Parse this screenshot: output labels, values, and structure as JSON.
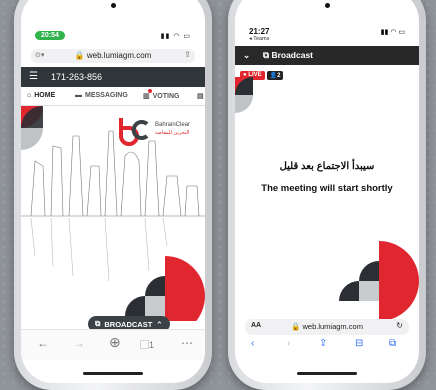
{
  "left_phone": {
    "status_time": "20:54",
    "url": "web.lumiagm.com",
    "meeting_id": "171-263-856",
    "tabs": [
      {
        "label": "HOME"
      },
      {
        "label": "MESSAGING"
      },
      {
        "label": "VOTING"
      }
    ],
    "logo_title": "BahrainClear",
    "logo_arabic": "البحرين للمقاصة",
    "broadcast_label": "BROADCAST"
  },
  "right_phone": {
    "status_time": "21:27",
    "back_app": "◂ Teams",
    "header_title": "Broadcast",
    "live_label": "LIVE",
    "viewers": "2",
    "arabic_message": "سيبدأ الاجتماع بعد قليل",
    "english_message": "The meeting will start shortly",
    "url_text_size": "AA",
    "url": "web.lumiagm.com"
  },
  "colors": {
    "accent_red": "#e0262f",
    "dark_bar": "#30373a",
    "time_green": "#2fb34a",
    "link_blue": "#2c6ff5"
  }
}
